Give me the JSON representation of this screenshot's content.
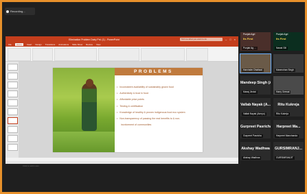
{
  "recording": {
    "label": "Recording..."
  },
  "ppt": {
    "title": "Elimination Problem Dairy Pnt. (1) - PowerPoint",
    "search_placeholder": "Tell me what you want to do",
    "tabs": [
      "File",
      "Home",
      "Insert",
      "Design",
      "Transitions",
      "Animations",
      "Slide Show",
      "Review",
      "View"
    ],
    "notes_placeholder": "Click to add notes"
  },
  "slide": {
    "heading": "PROBLEMS",
    "bullets": [
      "Inconsistent availability of sustainably grown food",
      "Authenticity & trust in food",
      "Affordable price points",
      "Testing & certification",
      "Knowledge of healthy & proven indigenous food eco system",
      "Non-transparency of passing the real benefits to & non-"
    ],
    "bullet_cont": "involvement of communities"
  },
  "participants": [
    {
      "name": "Punjab Ag ...",
      "brand": "Punjab Agri",
      "brand2": "Its First"
    },
    {
      "name": "Nawal Gill",
      "brand": "Punjab Agri",
      "brand2": "Its First"
    },
    {
      "name": "Harvinder Dhaliwal"
    },
    {
      "name": "Manmohan Singh"
    },
    {
      "name": "Manoj Jindal",
      "big": "Mandeep Singh (Amrit)"
    },
    {
      "name": "Harry Grewal"
    },
    {
      "name": "Vallab Nayak (Amryo)",
      "big": "Vallab Nayak (A..."
    },
    {
      "name": "Ritu Kukreja",
      "big": "Ritu Kukreja"
    },
    {
      "name": "Gurpreet Pasricha",
      "big": "Gurpreet Pasricha"
    },
    {
      "name": "Harpreet Manchanda",
      "big": "Harpreet Ma..."
    },
    {
      "name": "Akshay Wadhwa",
      "big": "Akshay Wadhwa"
    },
    {
      "name": "GURSIMRANJIT",
      "big": "GURSIMRANJ..."
    }
  ]
}
